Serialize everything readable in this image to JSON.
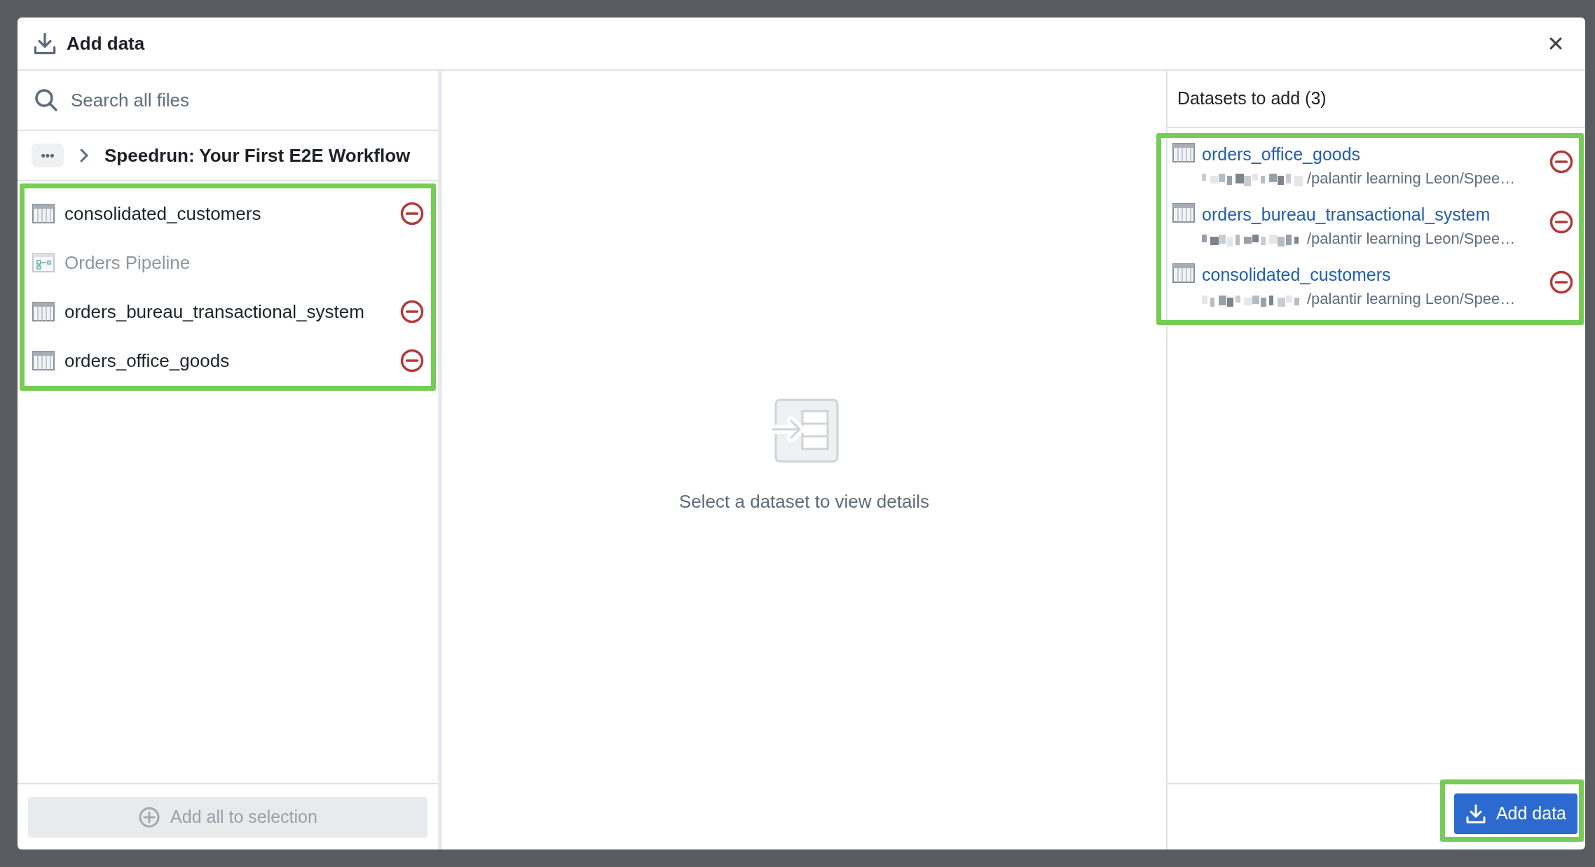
{
  "dialog": {
    "title": "Add data"
  },
  "search": {
    "placeholder": "Search all files"
  },
  "breadcrumb": {
    "more": "•••",
    "folder": "Speedrun: Your First E2E Workflow"
  },
  "files": [
    {
      "kind": "dataset",
      "name": "consolidated_customers",
      "disabled": false
    },
    {
      "kind": "pipeline",
      "name": "Orders Pipeline",
      "disabled": true
    },
    {
      "kind": "dataset",
      "name": "orders_bureau_transactional_system",
      "disabled": false
    },
    {
      "kind": "dataset",
      "name": "orders_office_goods",
      "disabled": false
    }
  ],
  "files_frame": {
    "highlighted": true
  },
  "add_all_button": {
    "label": "Add all to selection",
    "disabled": true
  },
  "details": {
    "empty_message": "Select a dataset to view details"
  },
  "selection": {
    "title": "Datasets to add (3)",
    "highlighted": true,
    "items": [
      {
        "name": "orders_office_goods",
        "path": "/palantir learning Leon/Spee…"
      },
      {
        "name": "orders_bureau_transactional_system",
        "path": "/palantir learning Leon/Spee…"
      },
      {
        "name": "consolidated_customers",
        "path": "/palantir learning Leon/Spee…"
      }
    ]
  },
  "add_button": {
    "label": "Add data",
    "highlighted": true
  }
}
